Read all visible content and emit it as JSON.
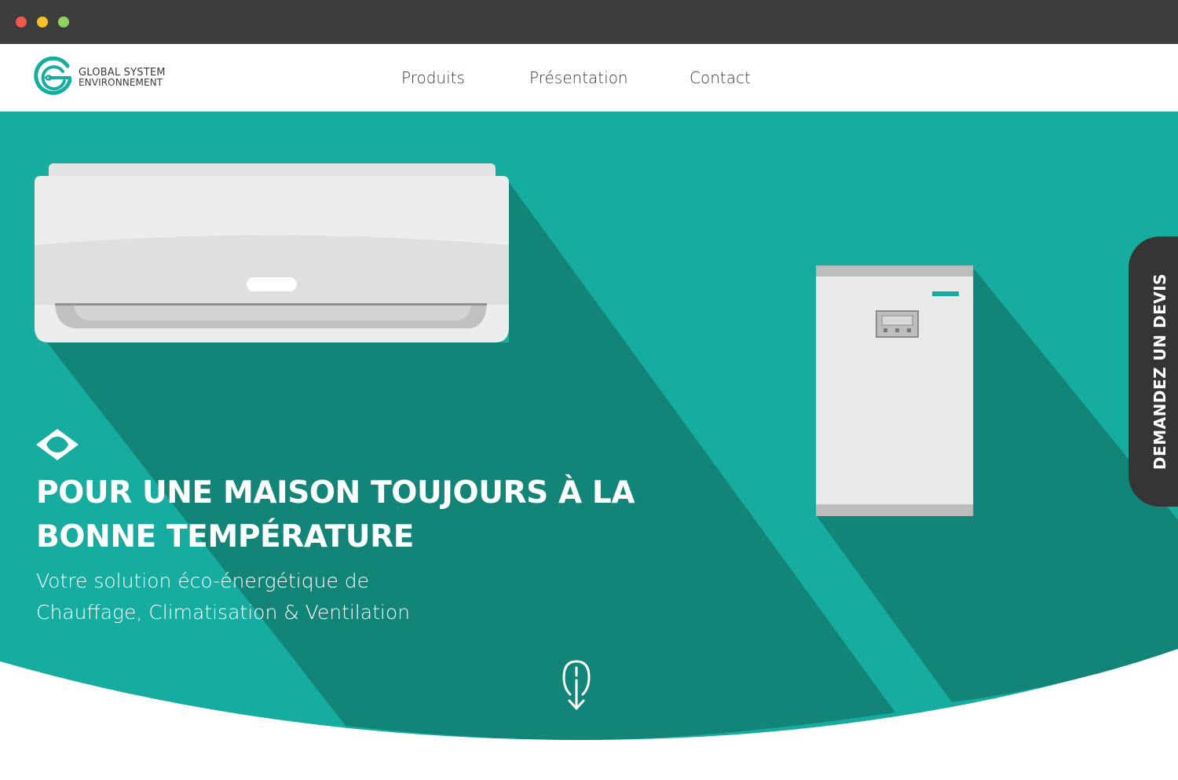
{
  "browser": {
    "buttons": [
      "close",
      "minimize",
      "maximize"
    ]
  },
  "header": {
    "logo": {
      "line1": "GLOBAL SYSTEM",
      "line2": "ENVIRONNEMENT",
      "icon": "gse-logo-icon"
    },
    "nav": [
      {
        "label": "Produits"
      },
      {
        "label": "Présentation"
      },
      {
        "label": "Contact"
      }
    ]
  },
  "hero": {
    "title_line1": "POUR UNE MAISON TOUJOURS À LA",
    "title_line2": "BONNE TEMPÉRATURE",
    "subtitle_line1": "Votre solution éco-énergétique de",
    "subtitle_line2": "Chauffage, Climatisation & Ventilation",
    "scroll_icon": "mouse-scroll-down-icon",
    "eye_icon": "eye-diamond-icon"
  },
  "side_cta": {
    "label": "DEMANDEZ UN DEVIS"
  },
  "colors": {
    "teal": "#16ac9f",
    "teal_shadow": "#138578",
    "chrome": "#3d3d3d",
    "cta_bg": "#353535",
    "appliance": "#e9e9e9"
  }
}
